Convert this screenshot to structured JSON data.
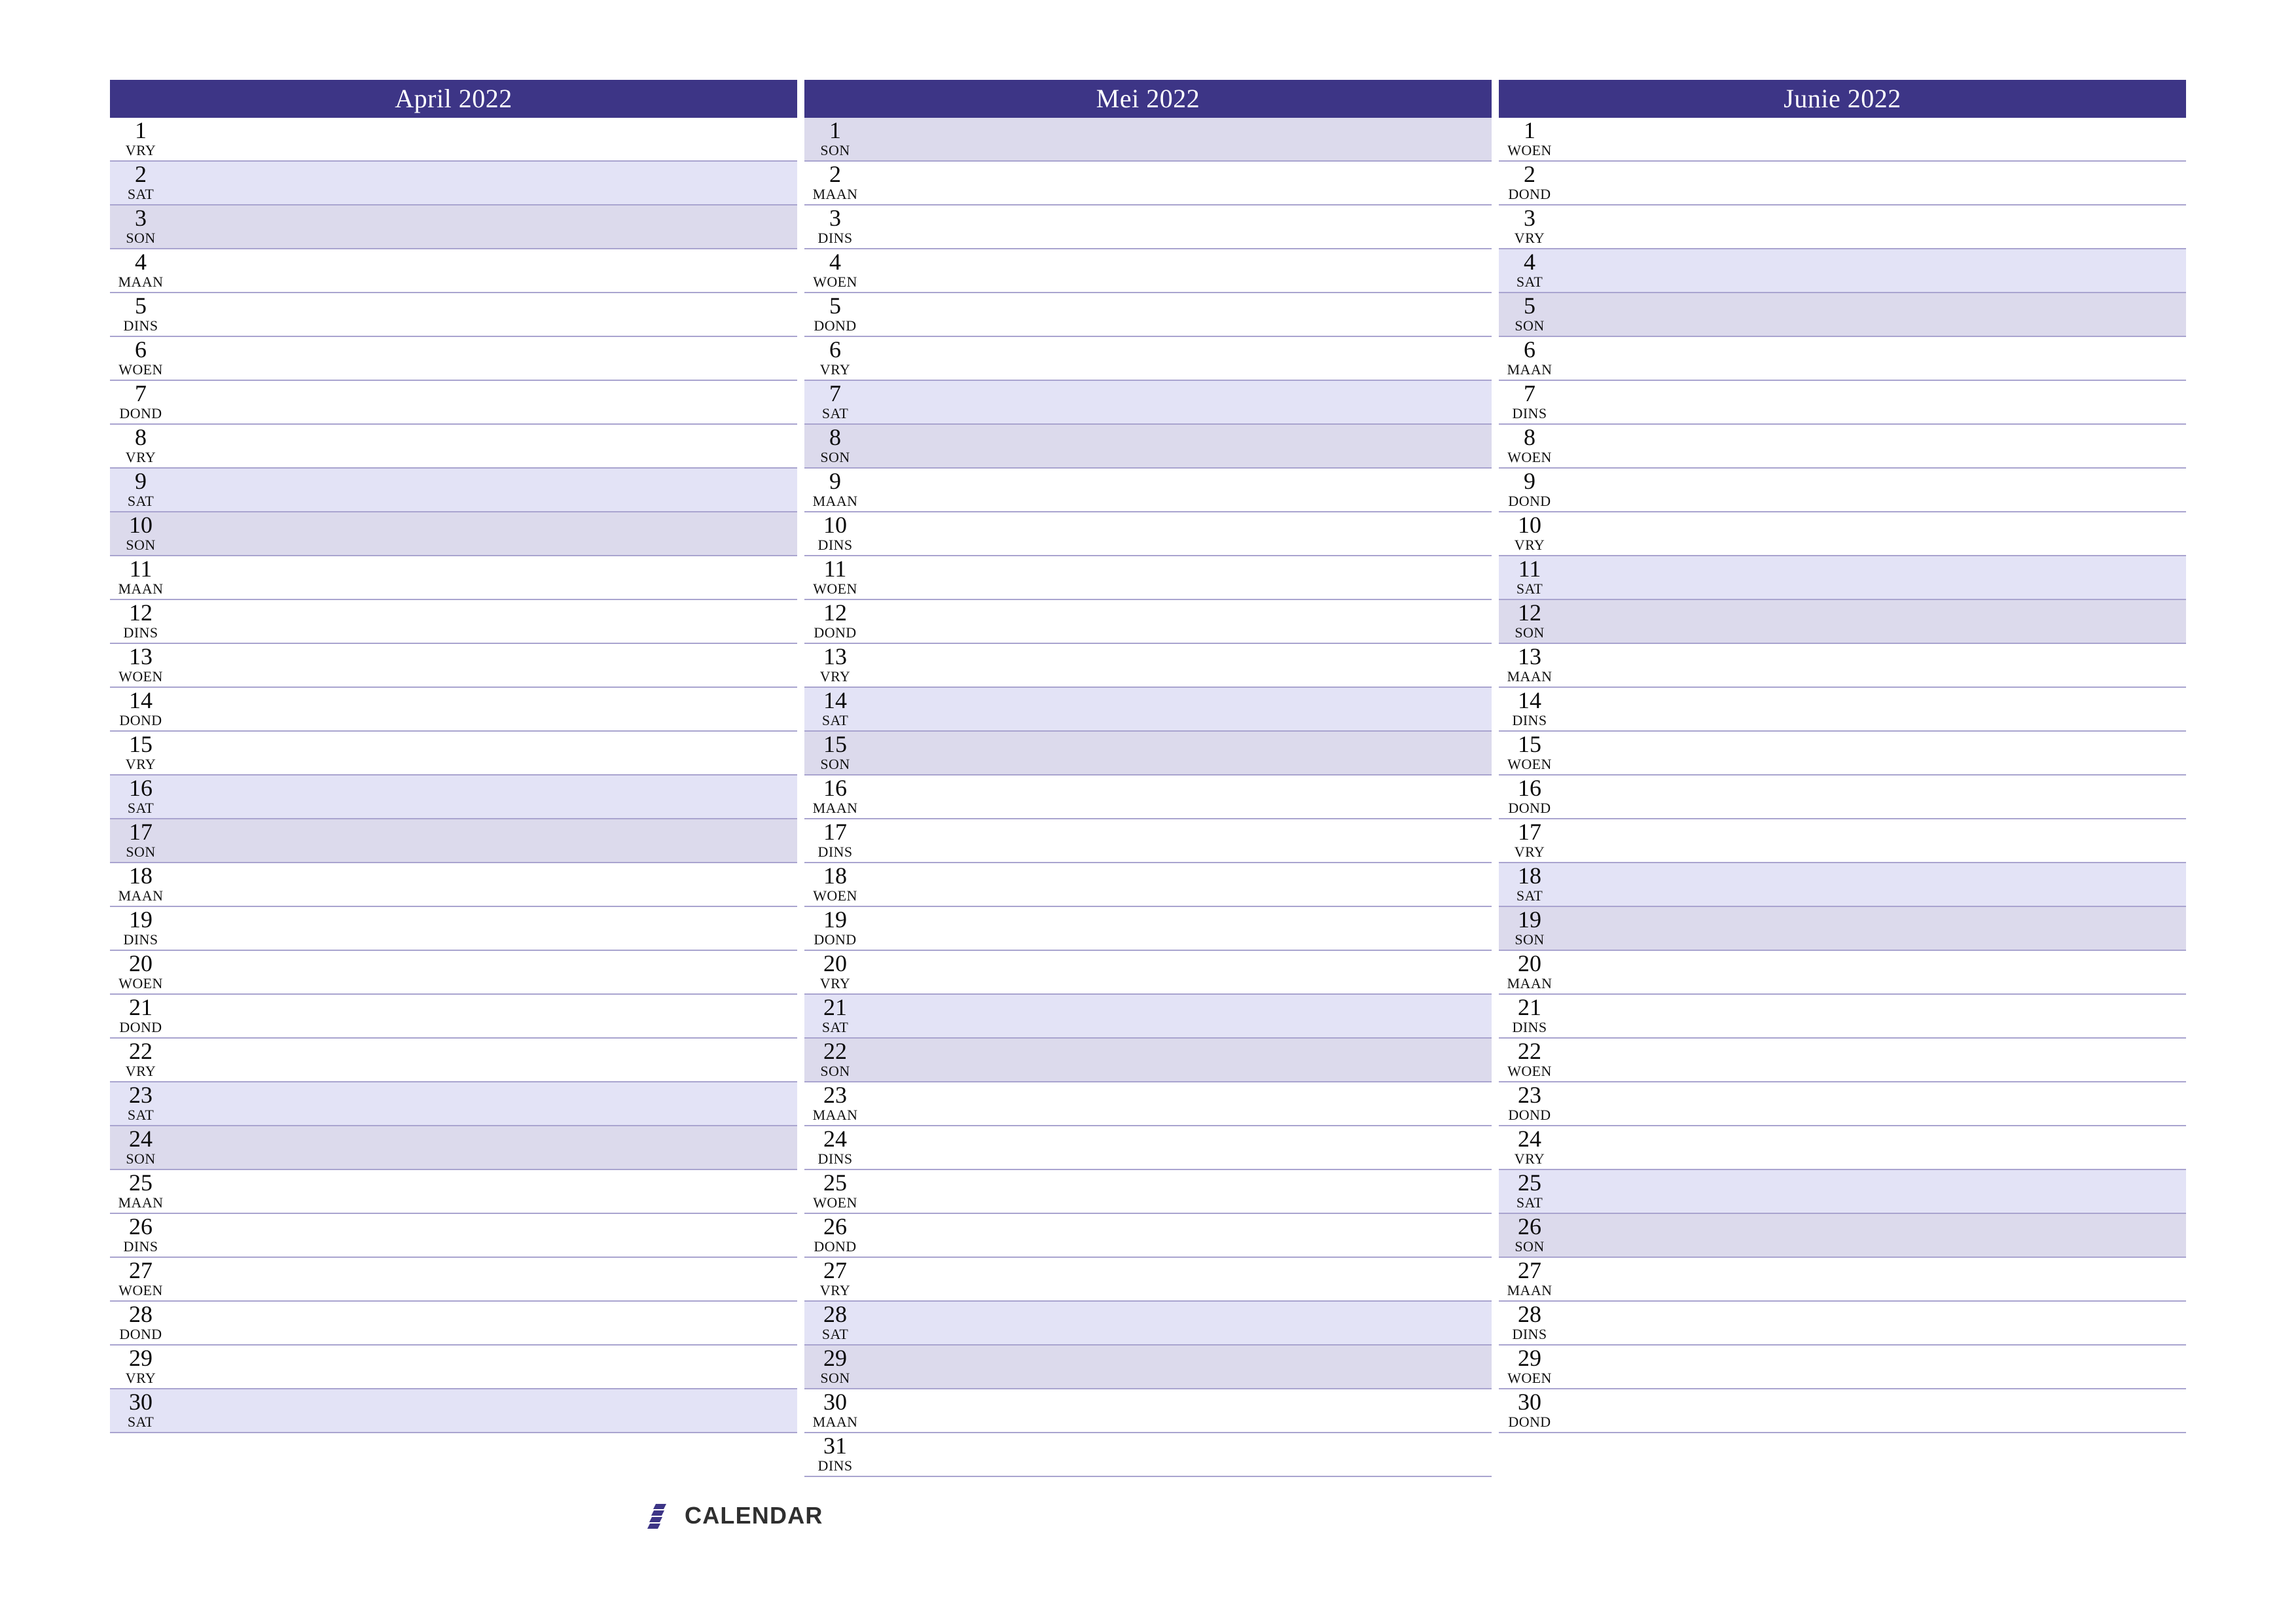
{
  "page": {
    "title": "Calendar planner April - Junie 2022",
    "language": "Afrikaans",
    "background_color": "#ffffff",
    "header_color": "#3d3586",
    "saturday_color": "#e3e3f6",
    "sunday_color": "#dcdaec",
    "gridline_color": "#a9a4cf"
  },
  "footer": {
    "logo_text": "CALENDAR",
    "logo_mark_name": "calendar-logo-mark",
    "logo_mark_color": "#3d3586",
    "logo_text_color": "#2f2f2f"
  },
  "months": [
    {
      "title": "April 2022",
      "name": "April",
      "year": "2022",
      "days": [
        {
          "num": "1",
          "abbr": "VRY",
          "type": "weekday"
        },
        {
          "num": "2",
          "abbr": "SAT",
          "type": "sat"
        },
        {
          "num": "3",
          "abbr": "SON",
          "type": "sun"
        },
        {
          "num": "4",
          "abbr": "MAAN",
          "type": "weekday"
        },
        {
          "num": "5",
          "abbr": "DINS",
          "type": "weekday"
        },
        {
          "num": "6",
          "abbr": "WOEN",
          "type": "weekday"
        },
        {
          "num": "7",
          "abbr": "DOND",
          "type": "weekday"
        },
        {
          "num": "8",
          "abbr": "VRY",
          "type": "weekday"
        },
        {
          "num": "9",
          "abbr": "SAT",
          "type": "sat"
        },
        {
          "num": "10",
          "abbr": "SON",
          "type": "sun"
        },
        {
          "num": "11",
          "abbr": "MAAN",
          "type": "weekday"
        },
        {
          "num": "12",
          "abbr": "DINS",
          "type": "weekday"
        },
        {
          "num": "13",
          "abbr": "WOEN",
          "type": "weekday"
        },
        {
          "num": "14",
          "abbr": "DOND",
          "type": "weekday"
        },
        {
          "num": "15",
          "abbr": "VRY",
          "type": "weekday"
        },
        {
          "num": "16",
          "abbr": "SAT",
          "type": "sat"
        },
        {
          "num": "17",
          "abbr": "SON",
          "type": "sun"
        },
        {
          "num": "18",
          "abbr": "MAAN",
          "type": "weekday"
        },
        {
          "num": "19",
          "abbr": "DINS",
          "type": "weekday"
        },
        {
          "num": "20",
          "abbr": "WOEN",
          "type": "weekday"
        },
        {
          "num": "21",
          "abbr": "DOND",
          "type": "weekday"
        },
        {
          "num": "22",
          "abbr": "VRY",
          "type": "weekday"
        },
        {
          "num": "23",
          "abbr": "SAT",
          "type": "sat"
        },
        {
          "num": "24",
          "abbr": "SON",
          "type": "sun"
        },
        {
          "num": "25",
          "abbr": "MAAN",
          "type": "weekday"
        },
        {
          "num": "26",
          "abbr": "DINS",
          "type": "weekday"
        },
        {
          "num": "27",
          "abbr": "WOEN",
          "type": "weekday"
        },
        {
          "num": "28",
          "abbr": "DOND",
          "type": "weekday"
        },
        {
          "num": "29",
          "abbr": "VRY",
          "type": "weekday"
        },
        {
          "num": "30",
          "abbr": "SAT",
          "type": "sat"
        }
      ]
    },
    {
      "title": "Mei 2022",
      "name": "Mei",
      "year": "2022",
      "days": [
        {
          "num": "1",
          "abbr": "SON",
          "type": "sun"
        },
        {
          "num": "2",
          "abbr": "MAAN",
          "type": "weekday"
        },
        {
          "num": "3",
          "abbr": "DINS",
          "type": "weekday"
        },
        {
          "num": "4",
          "abbr": "WOEN",
          "type": "weekday"
        },
        {
          "num": "5",
          "abbr": "DOND",
          "type": "weekday"
        },
        {
          "num": "6",
          "abbr": "VRY",
          "type": "weekday"
        },
        {
          "num": "7",
          "abbr": "SAT",
          "type": "sat"
        },
        {
          "num": "8",
          "abbr": "SON",
          "type": "sun"
        },
        {
          "num": "9",
          "abbr": "MAAN",
          "type": "weekday"
        },
        {
          "num": "10",
          "abbr": "DINS",
          "type": "weekday"
        },
        {
          "num": "11",
          "abbr": "WOEN",
          "type": "weekday"
        },
        {
          "num": "12",
          "abbr": "DOND",
          "type": "weekday"
        },
        {
          "num": "13",
          "abbr": "VRY",
          "type": "weekday"
        },
        {
          "num": "14",
          "abbr": "SAT",
          "type": "sat"
        },
        {
          "num": "15",
          "abbr": "SON",
          "type": "sun"
        },
        {
          "num": "16",
          "abbr": "MAAN",
          "type": "weekday"
        },
        {
          "num": "17",
          "abbr": "DINS",
          "type": "weekday"
        },
        {
          "num": "18",
          "abbr": "WOEN",
          "type": "weekday"
        },
        {
          "num": "19",
          "abbr": "DOND",
          "type": "weekday"
        },
        {
          "num": "20",
          "abbr": "VRY",
          "type": "weekday"
        },
        {
          "num": "21",
          "abbr": "SAT",
          "type": "sat"
        },
        {
          "num": "22",
          "abbr": "SON",
          "type": "sun"
        },
        {
          "num": "23",
          "abbr": "MAAN",
          "type": "weekday"
        },
        {
          "num": "24",
          "abbr": "DINS",
          "type": "weekday"
        },
        {
          "num": "25",
          "abbr": "WOEN",
          "type": "weekday"
        },
        {
          "num": "26",
          "abbr": "DOND",
          "type": "weekday"
        },
        {
          "num": "27",
          "abbr": "VRY",
          "type": "weekday"
        },
        {
          "num": "28",
          "abbr": "SAT",
          "type": "sat"
        },
        {
          "num": "29",
          "abbr": "SON",
          "type": "sun"
        },
        {
          "num": "30",
          "abbr": "MAAN",
          "type": "weekday"
        },
        {
          "num": "31",
          "abbr": "DINS",
          "type": "weekday"
        }
      ]
    },
    {
      "title": "Junie 2022",
      "name": "Junie",
      "year": "2022",
      "days": [
        {
          "num": "1",
          "abbr": "WOEN",
          "type": "weekday"
        },
        {
          "num": "2",
          "abbr": "DOND",
          "type": "weekday"
        },
        {
          "num": "3",
          "abbr": "VRY",
          "type": "weekday"
        },
        {
          "num": "4",
          "abbr": "SAT",
          "type": "sat"
        },
        {
          "num": "5",
          "abbr": "SON",
          "type": "sun"
        },
        {
          "num": "6",
          "abbr": "MAAN",
          "type": "weekday"
        },
        {
          "num": "7",
          "abbr": "DINS",
          "type": "weekday"
        },
        {
          "num": "8",
          "abbr": "WOEN",
          "type": "weekday"
        },
        {
          "num": "9",
          "abbr": "DOND",
          "type": "weekday"
        },
        {
          "num": "10",
          "abbr": "VRY",
          "type": "weekday"
        },
        {
          "num": "11",
          "abbr": "SAT",
          "type": "sat"
        },
        {
          "num": "12",
          "abbr": "SON",
          "type": "sun"
        },
        {
          "num": "13",
          "abbr": "MAAN",
          "type": "weekday"
        },
        {
          "num": "14",
          "abbr": "DINS",
          "type": "weekday"
        },
        {
          "num": "15",
          "abbr": "WOEN",
          "type": "weekday"
        },
        {
          "num": "16",
          "abbr": "DOND",
          "type": "weekday"
        },
        {
          "num": "17",
          "abbr": "VRY",
          "type": "weekday"
        },
        {
          "num": "18",
          "abbr": "SAT",
          "type": "sat"
        },
        {
          "num": "19",
          "abbr": "SON",
          "type": "sun"
        },
        {
          "num": "20",
          "abbr": "MAAN",
          "type": "weekday"
        },
        {
          "num": "21",
          "abbr": "DINS",
          "type": "weekday"
        },
        {
          "num": "22",
          "abbr": "WOEN",
          "type": "weekday"
        },
        {
          "num": "23",
          "abbr": "DOND",
          "type": "weekday"
        },
        {
          "num": "24",
          "abbr": "VRY",
          "type": "weekday"
        },
        {
          "num": "25",
          "abbr": "SAT",
          "type": "sat"
        },
        {
          "num": "26",
          "abbr": "SON",
          "type": "sun"
        },
        {
          "num": "27",
          "abbr": "MAAN",
          "type": "weekday"
        },
        {
          "num": "28",
          "abbr": "DINS",
          "type": "weekday"
        },
        {
          "num": "29",
          "abbr": "WOEN",
          "type": "weekday"
        },
        {
          "num": "30",
          "abbr": "DOND",
          "type": "weekday"
        }
      ]
    }
  ]
}
